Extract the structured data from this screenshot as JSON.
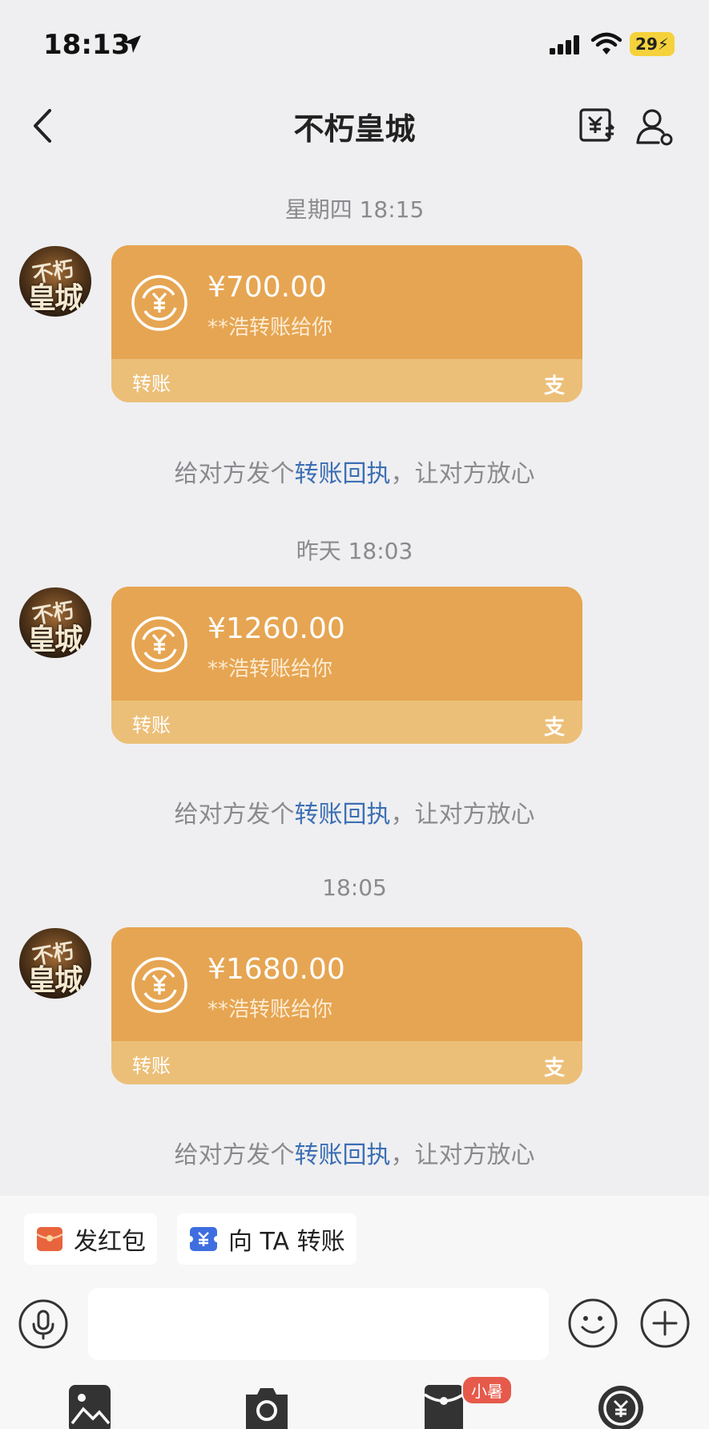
{
  "status_bar": {
    "time": "18:13",
    "battery": "29"
  },
  "nav": {
    "title": "不朽皇城"
  },
  "avatar": {
    "logo_top": "不朽",
    "logo_bottom": "皇城"
  },
  "messages": [
    {
      "time": "星期四 18:15",
      "amount": "¥700.00",
      "sender": "**浩转账给你",
      "label": "转账",
      "brand_glyph": "支"
    },
    {
      "time": "昨天 18:03",
      "amount": "¥1260.00",
      "sender": "**浩转账给你",
      "label": "转账",
      "brand_glyph": "支"
    },
    {
      "time": "18:05",
      "amount": "¥1680.00",
      "sender": "**浩转账给你",
      "label": "转账",
      "brand_glyph": "支"
    }
  ],
  "receipt_hint": {
    "prefix": "给对方发个",
    "link": "转账回执",
    "suffix": "，让对方放心"
  },
  "shortcuts": {
    "red_packet": "发红包",
    "transfer": "向 TA 转账"
  },
  "toolbar": {
    "badge": "小暑"
  },
  "colors": {
    "card": "#e6a552",
    "card_footer": "#ecbf78",
    "link": "#3c6fb4",
    "red_packet": "#e8643c",
    "transfer_icon": "#3e6ee0"
  }
}
